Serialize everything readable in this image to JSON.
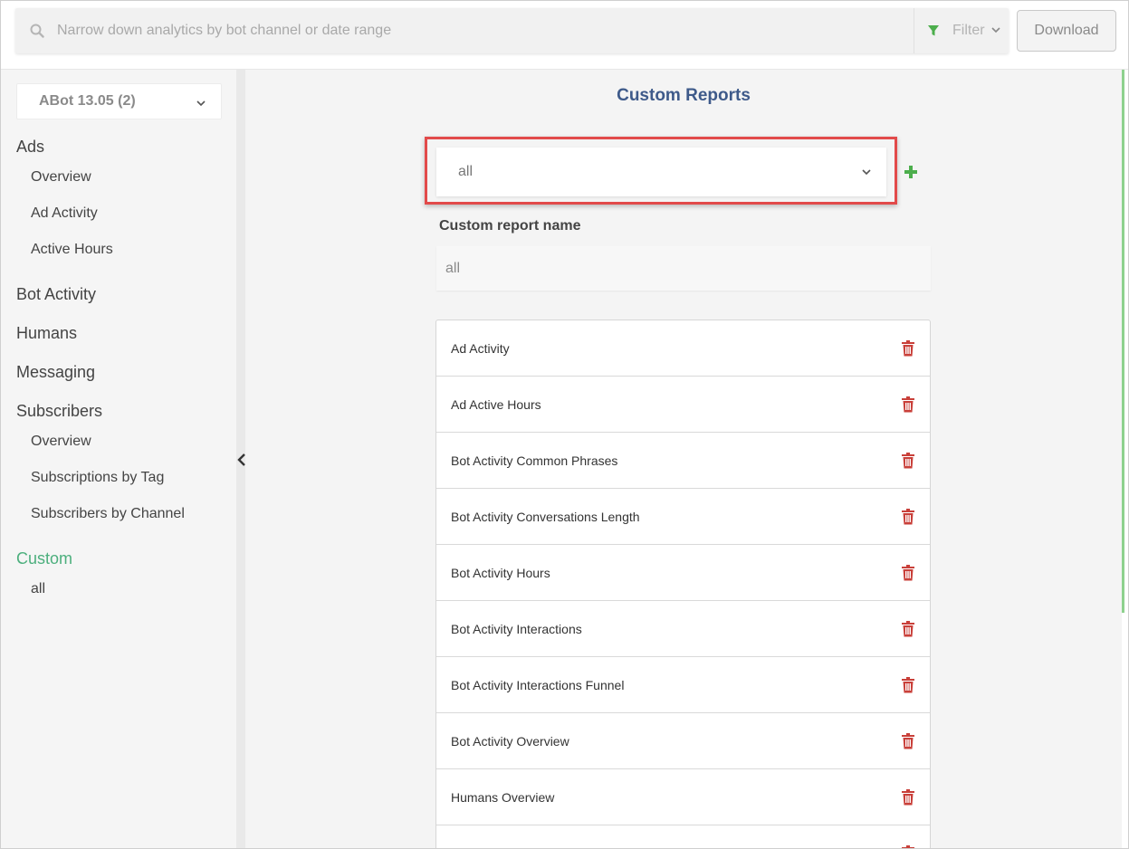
{
  "search": {
    "placeholder": "Narrow down analytics by bot channel or date range",
    "value": ""
  },
  "filter": {
    "label": "Filter"
  },
  "download": {
    "label": "Download"
  },
  "sidebar": {
    "bot_select": "ABot 13.05 (2)",
    "sections": [
      {
        "label": "Ads",
        "items": [
          "Overview",
          "Ad Activity",
          "Active Hours"
        ]
      },
      {
        "label": "Bot Activity",
        "items": []
      },
      {
        "label": "Humans",
        "items": []
      },
      {
        "label": "Messaging",
        "items": []
      },
      {
        "label": "Subscribers",
        "items": [
          "Overview",
          "Subscriptions by Tag",
          "Subscribers by Channel"
        ]
      },
      {
        "label": "Custom",
        "items": [
          "all"
        ]
      }
    ]
  },
  "main": {
    "title": "Custom Reports",
    "report_select": "all",
    "field_label": "Custom report name",
    "report_name_value": "all",
    "reports": [
      "Ad Activity",
      "Ad Active Hours",
      "Bot Activity Common Phrases",
      "Bot Activity Conversations Length",
      "Bot Activity Hours",
      "Bot Activity Interactions",
      "Bot Activity Interactions Funnel",
      "Bot Activity Overview",
      "Humans Overview"
    ]
  },
  "colors": {
    "accent_green": "#4caf7d",
    "title_blue": "#3e5a8a",
    "highlight_red": "#e24a4a",
    "trash_red": "#c9403a",
    "add_green": "#4cae4c"
  }
}
